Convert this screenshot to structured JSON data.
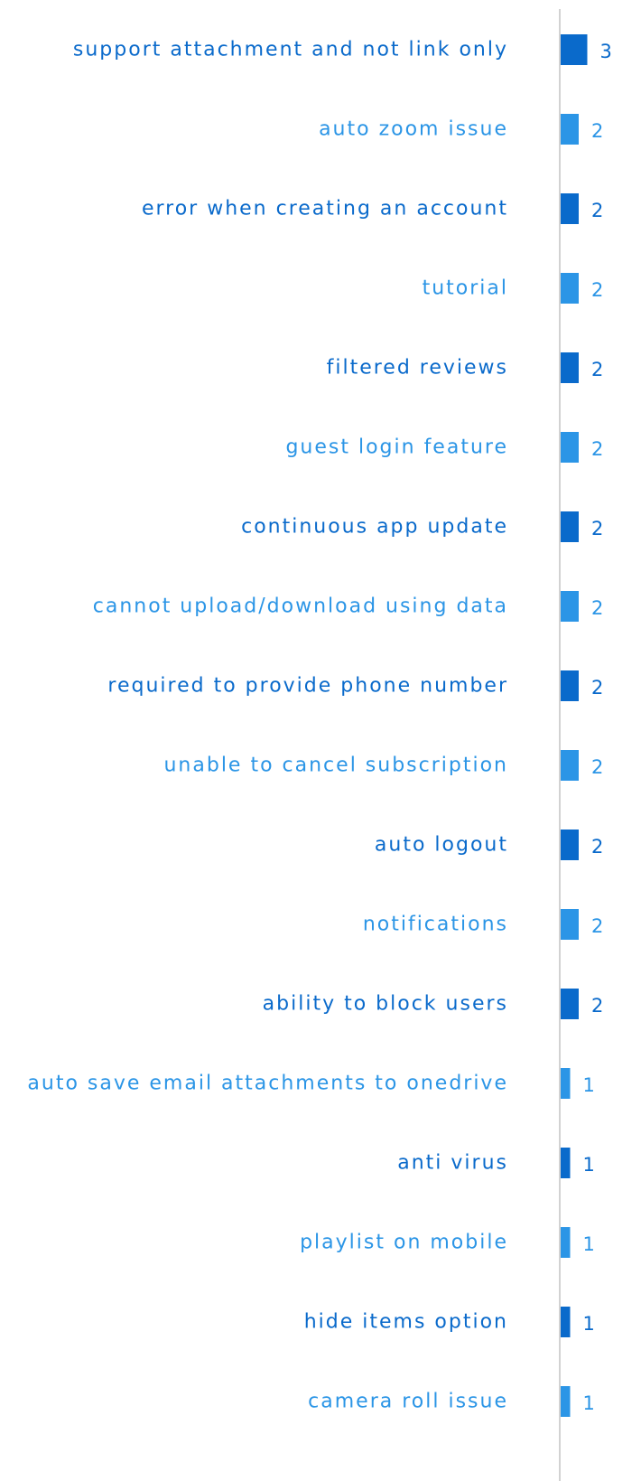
{
  "chart_data": {
    "type": "bar",
    "orientation": "horizontal",
    "categories": [
      "support attachment and not link only",
      "auto zoom issue",
      "error when creating an account",
      "tutorial",
      "filtered reviews",
      "guest login feature",
      "continuous app update",
      "cannot upload/download using data",
      "required to provide phone number",
      "unable to cancel subscription",
      "auto logout",
      "notifications",
      "ability to block users",
      "auto save email attachments to onedrive",
      "anti virus",
      "playlist on mobile",
      "hide items option",
      "camera roll issue"
    ],
    "values": [
      3,
      2,
      2,
      2,
      2,
      2,
      2,
      2,
      2,
      2,
      2,
      2,
      2,
      1,
      1,
      1,
      1,
      1
    ],
    "value_labels": [
      "3",
      "2",
      "2",
      "2",
      "2",
      "2",
      "2",
      "2",
      "2",
      "2",
      "2",
      "2",
      "2",
      "1",
      "1",
      "1",
      "1",
      "1"
    ],
    "colors": {
      "dark": "#0a6acb",
      "light": "#2b95e6",
      "axis": "#c4c4c4"
    },
    "color_pattern": "alternating dark/light",
    "grid": false,
    "legend": "none"
  }
}
